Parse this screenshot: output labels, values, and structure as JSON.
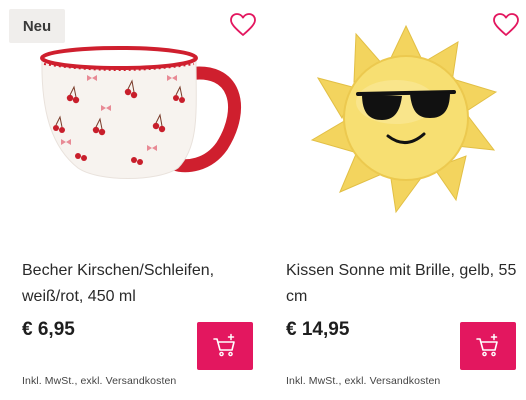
{
  "products": [
    {
      "badge": "Neu",
      "name": "Becher Kirschen/Schleifen, weiß/rot, 450 ml",
      "price": "€ 6,95",
      "tax_note": "Inkl. MwSt., exkl. Versandkosten",
      "image": "cherry-bow-mug"
    },
    {
      "name": "Kissen Sonne mit Brille, gelb, 55 cm",
      "price": "€ 14,95",
      "tax_note": "Inkl. MwSt., exkl. Versandkosten",
      "image": "sun-pillow-with-sunglasses"
    }
  ],
  "icons": {
    "favorite": "heart-outline-icon",
    "cart": "cart-add-icon"
  },
  "colors": {
    "accent": "#e3175f",
    "badge_bg": "#f0eeec",
    "mug_red": "#cf1f2e",
    "sun_yellow": "#f6dc6a"
  }
}
